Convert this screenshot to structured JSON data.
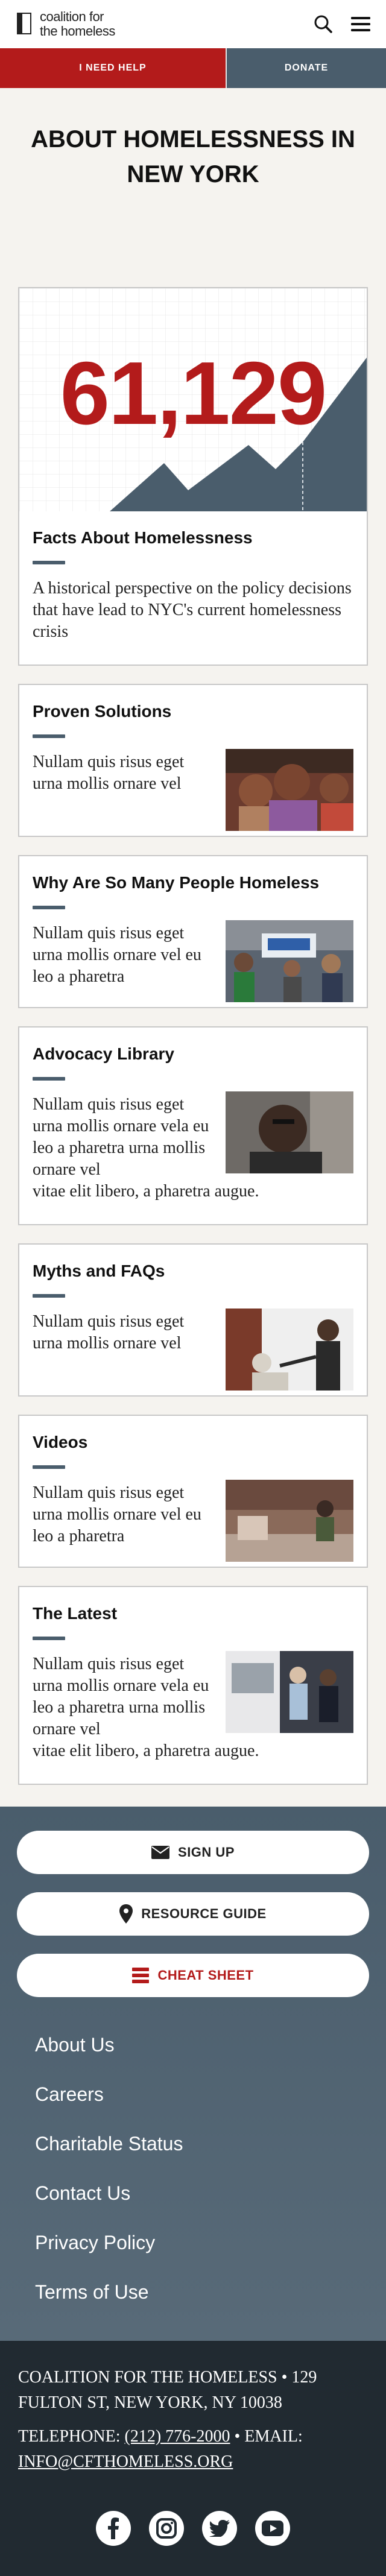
{
  "header": {
    "logo_line1": "coalition for",
    "logo_line2": "the homeless",
    "search_icon": "search-icon",
    "menu_icon": "hamburger-menu-icon"
  },
  "cta": {
    "help_label": "I NEED HELP",
    "donate_label": "DONATE"
  },
  "page_title": "ABOUT HOMELESSNESS IN NEW YORK",
  "hero_card": {
    "stat": "61,129",
    "title": "Facts About Homelessness",
    "description": "A historical perspective on the policy decisions that have lead to NYC's current homelessness crisis"
  },
  "cards": [
    {
      "title": "Proven Solutions",
      "description": "Nullam quis risus eget urna mollis ornare vel"
    },
    {
      "title": "Why Are So Many People Homeless",
      "description": "Nullam quis risus eget urna mollis ornare vel eu leo a pharetra"
    },
    {
      "title": "Advocacy Library",
      "description": "Nullam quis risus eget urna mollis ornare vela eu leo a pharetra urna mollis ornare vel",
      "description_extra": "vitae elit libero, a pharetra augue."
    },
    {
      "title": "Myths and FAQs",
      "description": "Nullam quis risus eget urna mollis ornare vel"
    },
    {
      "title": "Videos",
      "description": "Nullam quis risus eget urna mollis ornare vel eu leo a pharetra"
    },
    {
      "title": "The Latest",
      "description": "Nullam quis risus eget urna mollis ornare vela eu leo a pharetra urna mollis ornare vel",
      "description_extra": "vitae elit libero, a pharetra augue."
    }
  ],
  "footer_buttons": {
    "signup": "SIGN UP",
    "resource_guide": "RESOURCE GUIDE",
    "cheat_sheet": "CHEAT SHEET"
  },
  "footer_links": [
    "About Us",
    "Careers",
    "Charitable Status",
    "Contact Us",
    "Privacy Policy",
    "Terms of Use"
  ],
  "footer_address": "COALITION FOR THE HOMELESS • 129 FULTON ST, NEW YORK, NY 10038",
  "footer_contact": {
    "telephone_label": "TELEPHONE:",
    "telephone": "(212) 776-2000",
    "email_label": "• EMAIL:",
    "email": "INFO@CFTHOMELESS.ORG"
  },
  "colors": {
    "brand_red": "#b31b1b",
    "slate": "#4a5d6c",
    "footer_dark": "#212a31"
  }
}
